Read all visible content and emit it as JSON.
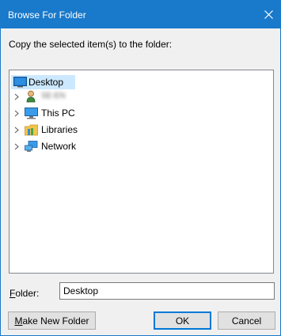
{
  "window": {
    "title": "Browse For Folder",
    "accent_color": "#1979ca",
    "close_glyph": "✕"
  },
  "prompt": "Copy the selected item(s) to the folder:",
  "tree": {
    "items": [
      {
        "label": "Desktop",
        "icon": "desktop-icon",
        "selected": true,
        "expandable": false
      },
      {
        "label": "SE-EN",
        "icon": "user-icon",
        "selected": false,
        "expandable": true,
        "blurred": true
      },
      {
        "label": "This PC",
        "icon": "computer-icon",
        "selected": false,
        "expandable": true
      },
      {
        "label": "Libraries",
        "icon": "libraries-icon",
        "selected": false,
        "expandable": true
      },
      {
        "label": "Network",
        "icon": "network-icon",
        "selected": false,
        "expandable": true
      }
    ]
  },
  "folder": {
    "label_prefix": "",
    "label_mnemonic": "F",
    "label_rest": "older:",
    "value": "Desktop"
  },
  "buttons": {
    "new_folder_mnemonic": "M",
    "new_folder_rest": "ake New Folder",
    "ok": "OK",
    "cancel": "Cancel"
  }
}
